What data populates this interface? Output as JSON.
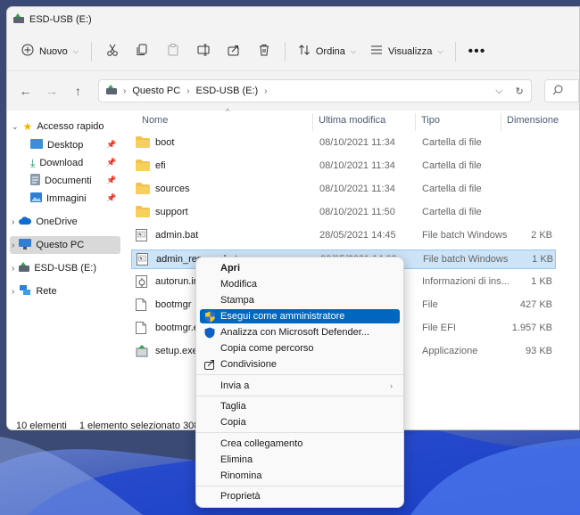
{
  "window": {
    "title": "ESD-USB (E:)"
  },
  "toolbar": {
    "new_label": "Nuovo",
    "sort_label": "Ordina",
    "view_label": "Visualizza"
  },
  "address": {
    "crumbs": [
      "Questo PC",
      "ESD-USB (E:)"
    ]
  },
  "sidebar": {
    "items": [
      {
        "label": "Accesso rapido"
      },
      {
        "label": "Desktop"
      },
      {
        "label": "Download"
      },
      {
        "label": "Documenti"
      },
      {
        "label": "Immagini"
      },
      {
        "label": "OneDrive"
      },
      {
        "label": "Questo PC"
      },
      {
        "label": "ESD-USB (E:)"
      },
      {
        "label": "Rete"
      }
    ]
  },
  "columns": {
    "name": "Nome",
    "modified": "Ultima modifica",
    "type": "Tipo",
    "size": "Dimensione"
  },
  "files": [
    {
      "name": "boot",
      "modified": "08/10/2021 11:34",
      "type": "Cartella di file",
      "size": ""
    },
    {
      "name": "efi",
      "modified": "08/10/2021 11:34",
      "type": "Cartella di file",
      "size": ""
    },
    {
      "name": "sources",
      "modified": "08/10/2021 11:34",
      "type": "Cartella di file",
      "size": ""
    },
    {
      "name": "support",
      "modified": "08/10/2021 11:50",
      "type": "Cartella di file",
      "size": ""
    },
    {
      "name": "admin.bat",
      "modified": "28/05/2021 14:45",
      "type": "File batch Windows",
      "size": "2 KB"
    },
    {
      "name": "admin_remove.bat",
      "modified": "28/05/2021 14:08",
      "type": "File batch Windows",
      "size": "1 KB"
    },
    {
      "name": "autorun.inf",
      "modified": "",
      "type": "Informazioni di ins...",
      "size": "1 KB"
    },
    {
      "name": "bootmgr",
      "modified": "",
      "type": "File",
      "size": "427 KB"
    },
    {
      "name": "bootmgr.efi",
      "modified": "",
      "type": "File EFI",
      "size": "1.957 KB"
    },
    {
      "name": "setup.exe",
      "modified": "",
      "type": "Applicazione",
      "size": "93 KB"
    }
  ],
  "status": {
    "count": "10 elementi",
    "selection": "1 elemento selezionato  308 byte"
  },
  "context_menu": {
    "open": "Apri",
    "edit": "Modifica",
    "print": "Stampa",
    "run_admin": "Esegui come amministratore",
    "defender": "Analizza con Microsoft Defender...",
    "copy_path": "Copia come percorso",
    "share": "Condivisione",
    "send_to": "Invia a",
    "cut": "Taglia",
    "copy": "Copia",
    "shortcut": "Crea collegamento",
    "delete": "Elimina",
    "rename": "Rinomina",
    "properties": "Proprietà"
  },
  "colors": {
    "accent": "#0067c0",
    "selection": "#cce4f7",
    "folder": "#f2c14e"
  }
}
